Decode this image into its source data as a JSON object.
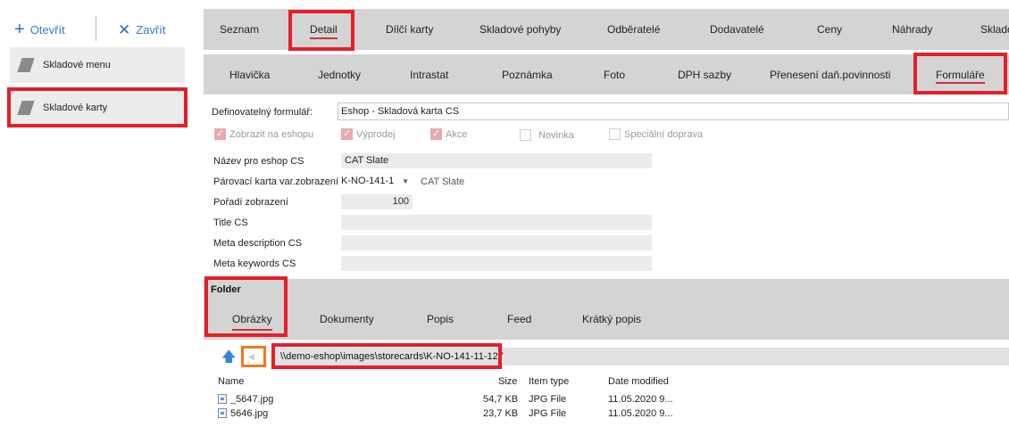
{
  "toolbar": {
    "open_label": "Otevřít",
    "close_label": "Zavřít"
  },
  "left_menu": [
    {
      "label": "Skladové menu"
    },
    {
      "label": "Skladové karty"
    }
  ],
  "main_tabs": [
    {
      "label": "Seznam"
    },
    {
      "label": "Detail"
    },
    {
      "label": "Dílčí karty"
    },
    {
      "label": "Skladové pohyby"
    },
    {
      "label": "Odběratelé"
    },
    {
      "label": "Dodavatelé"
    },
    {
      "label": "Ceny"
    },
    {
      "label": "Náhrady"
    },
    {
      "label": "Sklado"
    }
  ],
  "sub_tabs": [
    {
      "label": "Hlavička"
    },
    {
      "label": "Jednotky"
    },
    {
      "label": "Intrastat"
    },
    {
      "label": "Poznámka"
    },
    {
      "label": "Foto"
    },
    {
      "label": "DPH sazby"
    },
    {
      "label": "Přenesení daň.povinnosti"
    },
    {
      "label": "Formuláře"
    }
  ],
  "form": {
    "definable_form_label": "Definovatelný formulář:",
    "definable_form_value": "Eshop - Skladová karta CS",
    "checkboxes": [
      {
        "label": "Zobrazit na eshopu",
        "checked": true
      },
      {
        "label": "Výprodej",
        "checked": true
      },
      {
        "label": "Akce",
        "checked": true
      },
      {
        "label": "Novinka",
        "checked": false
      },
      {
        "label": "Speciální doprava",
        "checked": false
      }
    ],
    "fields": [
      {
        "label": "Název pro eshop CS",
        "value": "CAT Slate"
      },
      {
        "label": "Párovací karta var.zobrazení",
        "value": "K-NO-141-1",
        "extra": "CAT Slate"
      },
      {
        "label": "Pořadí zobrazení",
        "value": "100"
      },
      {
        "label": "Title CS",
        "value": ""
      },
      {
        "label": "Meta description CS",
        "value": ""
      },
      {
        "label": "Meta keywords CS",
        "value": ""
      }
    ]
  },
  "folder": {
    "title": "Folder",
    "tabs": [
      {
        "label": "Obrázky"
      },
      {
        "label": "Dokumenty"
      },
      {
        "label": "Popis"
      },
      {
        "label": "Feed"
      },
      {
        "label": "Krátký popis"
      }
    ],
    "path": "\\\\demo-eshop\\images\\storecards\\K-NO-141-11-127",
    "columns": {
      "name": "Name",
      "size": "Size",
      "type": "Item type",
      "date": "Date modified"
    },
    "files": [
      {
        "name": "_5647.jpg",
        "size": "54,7 KB",
        "type": "JPG File",
        "date": "11.05.2020 9..."
      },
      {
        "name": "5646.jpg",
        "size": "23,7 KB",
        "type": "JPG File",
        "date": "11.05.2020 9..."
      }
    ]
  },
  "colors": {
    "highlight_red": "#e3202a",
    "highlight_orange": "#f07a1b",
    "accent_blue": "#3a78c3"
  }
}
